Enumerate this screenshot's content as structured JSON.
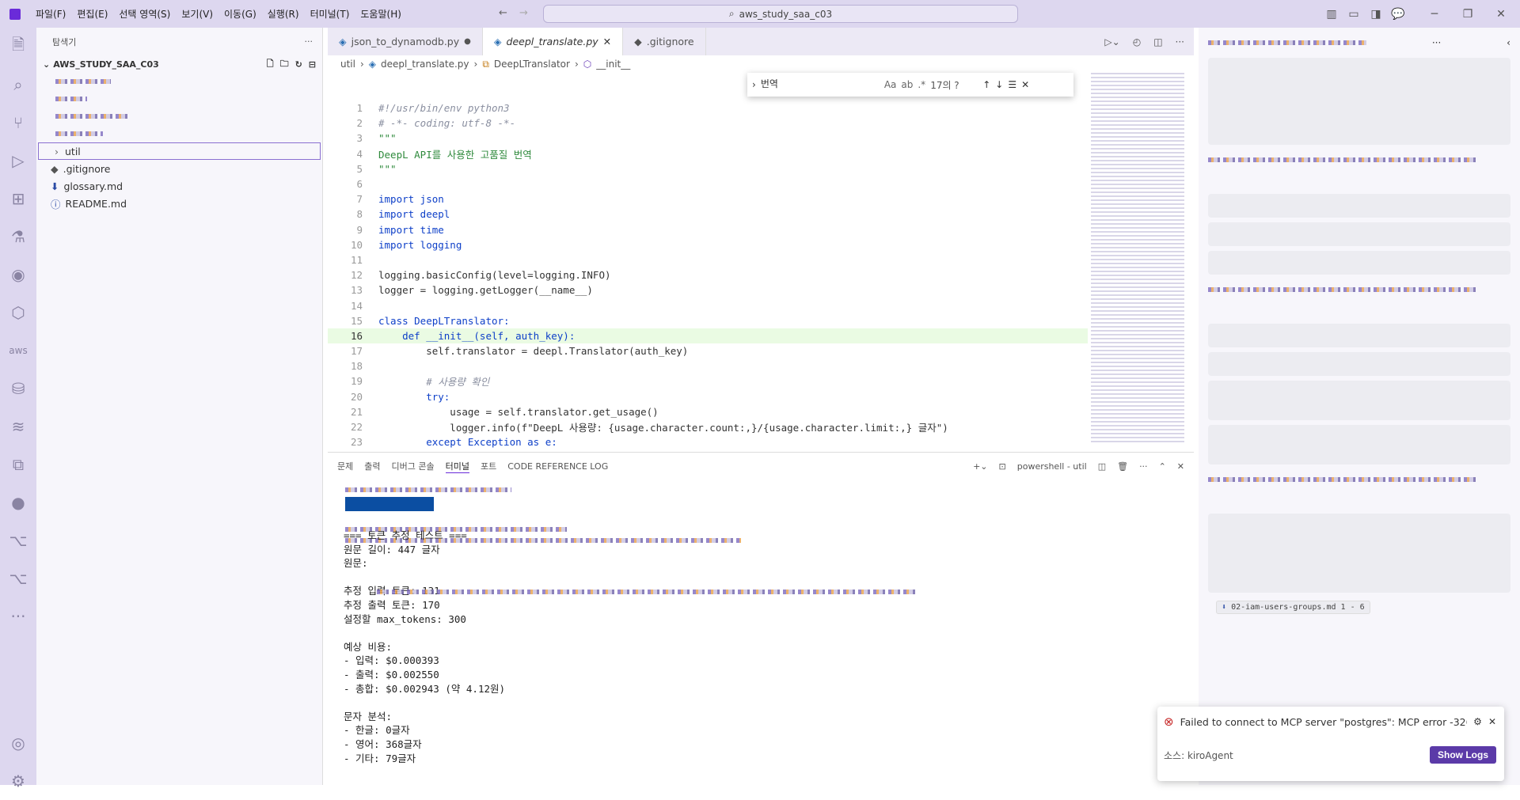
{
  "menu": [
    "파일(F)",
    "편집(E)",
    "선택 영역(S)",
    "보기(V)",
    "이동(G)",
    "실행(R)",
    "터미널(T)",
    "도움말(H)"
  ],
  "search_placeholder": "aws_study_saa_c03",
  "sidebar": {
    "title": "탐색기",
    "workspace": "AWS_STUDY_SAA_C03",
    "items": [
      "util",
      ".gitignore",
      "glossary.md",
      "README.md"
    ]
  },
  "tabs": [
    {
      "label": "json_to_dynamodb.py"
    },
    {
      "label": "deepl_translate.py"
    },
    {
      "label": ".gitignore"
    }
  ],
  "breadcrumbs": [
    "util",
    "deepl_translate.py",
    "DeepLTranslator",
    "__init__"
  ],
  "find": {
    "value": "번역",
    "result": "17의 ?"
  },
  "code": {
    "lines": [
      {
        "n": "1",
        "t": "#!/usr/bin/env python3"
      },
      {
        "n": "2",
        "t": "# -*- coding: utf-8 -*-"
      },
      {
        "n": "3",
        "t": "\"\"\""
      },
      {
        "n": "4",
        "t": "DeepL API를 사용한 고품질 번역"
      },
      {
        "n": "5",
        "t": "\"\"\""
      },
      {
        "n": "6",
        "t": ""
      },
      {
        "n": "7",
        "t": "import json"
      },
      {
        "n": "8",
        "t": "import deepl"
      },
      {
        "n": "9",
        "t": "import time"
      },
      {
        "n": "10",
        "t": "import logging"
      },
      {
        "n": "11",
        "t": ""
      },
      {
        "n": "12",
        "t": "logging.basicConfig(level=logging.INFO)"
      },
      {
        "n": "13",
        "t": "logger = logging.getLogger(__name__)"
      },
      {
        "n": "14",
        "t": ""
      },
      {
        "n": "15",
        "t": "class DeepLTranslator:"
      },
      {
        "n": "16",
        "t": "    def __init__(self, auth_key):"
      },
      {
        "n": "17",
        "t": "        self.translator = deepl.Translator(auth_key)"
      },
      {
        "n": "18",
        "t": ""
      },
      {
        "n": "19",
        "t": "        # 사용량 확인"
      },
      {
        "n": "20",
        "t": "        try:"
      },
      {
        "n": "21",
        "t": "            usage = self.translator.get_usage()"
      },
      {
        "n": "22",
        "t": "            logger.info(f\"DeepL 사용량: {usage.character.count:,}/{usage.character.limit:,} 글자\")"
      },
      {
        "n": "23",
        "t": "        except Exception as e:"
      }
    ]
  },
  "panel": {
    "tabs": [
      "문제",
      "출력",
      "디버그 콘솔",
      "터미널",
      "포트",
      "CODE REFERENCE LOG"
    ],
    "shell": "powershell - util"
  },
  "terminal": [
    "=== 토큰 추정 테스트 ===",
    "원문 길이: 447 글자",
    "원문: ",
    "",
    "추정 입력 토큰: 131",
    "추정 출력 토큰: 170",
    "설정할 max_tokens: 300",
    "",
    "예상 비용:",
    "- 입력: $0.000393",
    "- 출력: $0.002550",
    "- 총합: $0.002943 (약 4.12원)",
    "",
    "문자 분석:",
    "- 한글: 0글자",
    "- 영어: 368글자",
    "- 기타: 79글자"
  ],
  "chat": {
    "file_ref": "02-iam-users-groups.md 1 - 6"
  },
  "toast": {
    "message": "Failed to connect to MCP server \"postgres\": MCP error -32603:",
    "source": "소스: kiroAgent",
    "button": "Show Logs"
  }
}
